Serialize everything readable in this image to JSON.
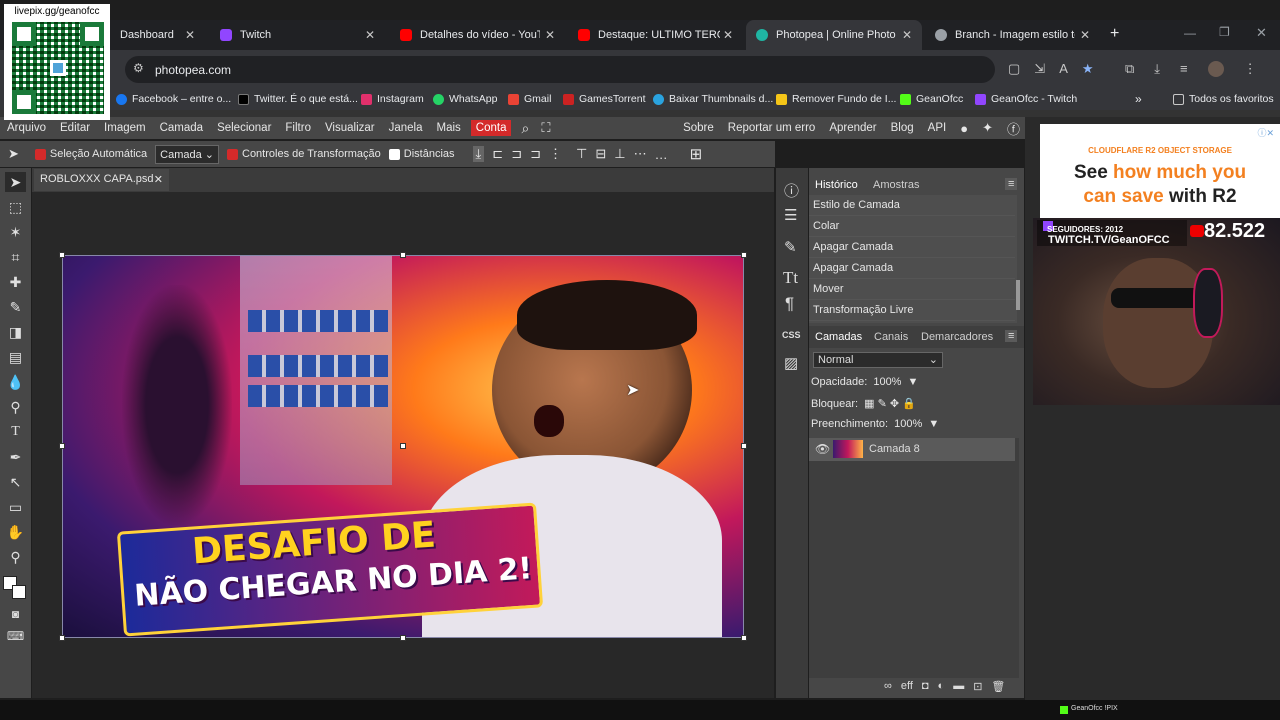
{
  "browser": {
    "tabs": [
      {
        "label": "Dashboard",
        "color": "#9146ff"
      },
      {
        "label": "Twitch",
        "color": "#9146ff"
      },
      {
        "label": "Detalhes do vídeo - YouTube",
        "color": "#ff0000"
      },
      {
        "label": "Destaque: ULTIMO TERÇA D",
        "color": "#ff0000"
      },
      {
        "label": "Photopea | Online Photo Edi",
        "color": "#1fb5a3"
      },
      {
        "label": "Branch - Imagem estilo terro",
        "color": "#9aa0a6"
      }
    ],
    "url": "photopea.com",
    "bookmarks": [
      {
        "label": "Facebook – entre o...",
        "color": "#1877f2"
      },
      {
        "label": "Twitter. É o que está...",
        "color": "#ffffff"
      },
      {
        "label": "Instagram",
        "color": "#e1306c"
      },
      {
        "label": "WhatsApp",
        "color": "#25d366"
      },
      {
        "label": "Gmail",
        "color": "#ea4335"
      },
      {
        "label": "GamesTorrent",
        "color": "#cc2222"
      },
      {
        "label": "Baixar Thumbnails d...",
        "color": "#2aa3e0"
      },
      {
        "label": "Remover Fundo de I...",
        "color": "#f5c518"
      },
      {
        "label": "GeanOfcc",
        "color": "#53fc18"
      },
      {
        "label": "GeanOfcc - Twitch",
        "color": "#9146ff"
      }
    ],
    "all_bookmarks": "Todos os favoritos"
  },
  "menu": {
    "left": [
      "Arquivo",
      "Editar",
      "Imagem",
      "Camada",
      "Selecionar",
      "Filtro",
      "Visualizar",
      "Janela",
      "Mais"
    ],
    "account": "Conta",
    "right": [
      "Sobre",
      "Reportar um erro",
      "Aprender",
      "Blog",
      "API"
    ]
  },
  "options": {
    "auto_select": "Seleção Automática",
    "layer_select": "Camada",
    "transform_controls": "Controles de Transformação",
    "distances": "Distâncias"
  },
  "document": {
    "tab": "ROBLOXXX CAPA.psd",
    "thumb_line1": "DESAFIO DE",
    "thumb_line2": "NÃO CHEGAR NO DIA 2!"
  },
  "history": {
    "tabs": [
      "Histórico",
      "Amostras"
    ],
    "items": [
      "Estilo de Camada",
      "Colar",
      "Apagar Camada",
      "Apagar Camada",
      "Mover",
      "Transformação Livre"
    ]
  },
  "layers": {
    "tabs": [
      "Camadas",
      "Canais",
      "Demarcadores"
    ],
    "blend": "Normal",
    "opacity_label": "Opacidade:",
    "opacity": "100%",
    "lock_label": "Bloquear:",
    "fill_label": "Preenchimento:",
    "fill": "100%",
    "items": [
      {
        "name": "Camada 8"
      }
    ]
  },
  "overlay": {
    "qr_text": "livepix.gg/geanofcc",
    "ad_top": "CLOUDFLARE R2 OBJECT STORAGE",
    "ad_line1a": "See ",
    "ad_line1b": "how much you",
    "ad_line2a": "can save ",
    "ad_line2b": "with R2",
    "followers": "SEGUIDORES: 2012",
    "channel": "TWITCH.TV/GeanOFCC",
    "count": "82.522",
    "pix": "GeanOfcc !PIX"
  }
}
